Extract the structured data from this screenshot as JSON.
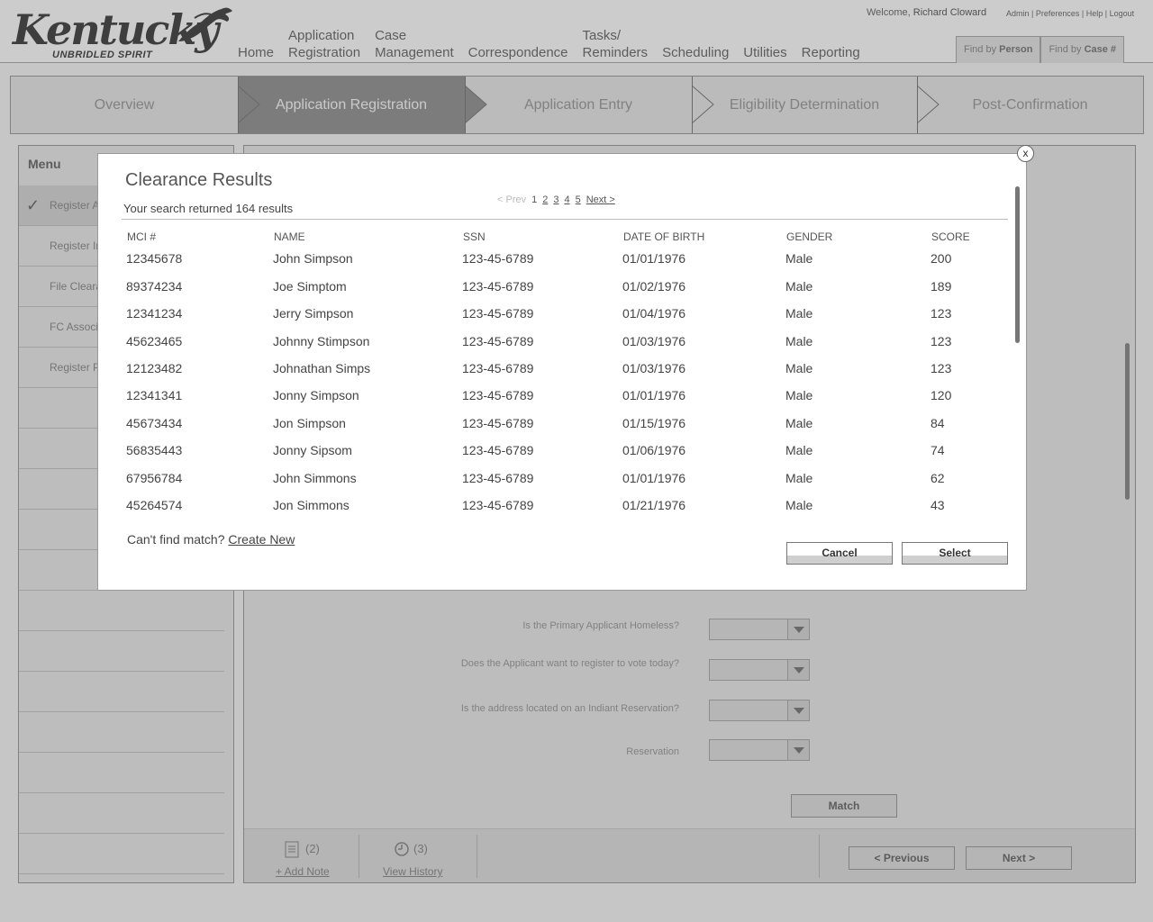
{
  "header": {
    "logo_word": "Kentucky",
    "logo_tagline": "UNBRIDLED SPIRIT",
    "nav": [
      {
        "line1": "",
        "line2": "Home"
      },
      {
        "line1": "Application",
        "line2": "Registration"
      },
      {
        "line1": "Case",
        "line2": "Management"
      },
      {
        "line1": "",
        "line2": "Correspondence"
      },
      {
        "line1": "Tasks/",
        "line2": "Reminders"
      },
      {
        "line1": "",
        "line2": "Scheduling"
      },
      {
        "line1": "",
        "line2": "Utilities"
      },
      {
        "line1": "",
        "line2": "Reporting"
      }
    ],
    "welcome_prefix": "Welcome,",
    "user_name": "Richard Cloward",
    "links": {
      "admin": "Admin",
      "preferences": "Preferences",
      "help": "Help",
      "logout": "Logout",
      "sep": " | "
    },
    "find_person": {
      "prefix": "Find by ",
      "bold": "Person"
    },
    "find_case": {
      "prefix": "Find by ",
      "bold": "Case #"
    }
  },
  "steps": [
    {
      "label": "Overview",
      "active": false
    },
    {
      "label": "Application Registration",
      "active": true
    },
    {
      "label": "Application Entry",
      "active": false
    },
    {
      "label": "Eligibility Determination",
      "active": false
    },
    {
      "label": "Post-Confirmation",
      "active": false
    }
  ],
  "menu": {
    "title": "Menu",
    "items": [
      "Register A",
      "Register In",
      "File Cleara",
      "FC Associa",
      "Register P"
    ]
  },
  "form": {
    "q1": "Is the Primary Applicant Homeless?",
    "q2": "Does the Applicant want to register to vote today?",
    "q3": "Is the address located on an Indiant Reservation?",
    "q4": "Reservation",
    "match_label": "Match",
    "add_note_count": "(2)",
    "add_note_label": "+ Add Note",
    "history_count": "(3)",
    "history_label": "View History",
    "previous_label": "< Previous",
    "next_label": "Next >"
  },
  "modal": {
    "title": "Clearance Results",
    "count_text": "Your search returned 164 results",
    "pager": {
      "prev": "< Prev",
      "pages": [
        "1",
        "2",
        "3",
        "4",
        "5"
      ],
      "next": "Next >"
    },
    "columns": [
      "MCI #",
      "NAME",
      "SSN",
      "DATE OF BIRTH",
      "GENDER",
      "SCORE"
    ],
    "rows": [
      [
        "12345678",
        "John Simpson",
        "123-45-6789",
        "01/01/1976",
        "Male",
        "200"
      ],
      [
        "89374234",
        "Joe Simptom",
        "123-45-6789",
        "01/02/1976",
        "Male",
        "189"
      ],
      [
        "12341234",
        "Jerry Simpson",
        "123-45-6789",
        "01/04/1976",
        "Male",
        "123"
      ],
      [
        "45623465",
        "Johnny Stimpson",
        "123-45-6789",
        "01/03/1976",
        "Male",
        "123"
      ],
      [
        "12123482",
        "Johnathan Simps",
        "123-45-6789",
        "01/03/1976",
        "Male",
        "123"
      ],
      [
        "12341341",
        "Jonny Simpson",
        "123-45-6789",
        "01/01/1976",
        "Male",
        "120"
      ],
      [
        "45673434",
        "Jon Simpson",
        "123-45-6789",
        "01/15/1976",
        "Male",
        "84"
      ],
      [
        "56835443",
        "Jonny Sipsom",
        "123-45-6789",
        "01/06/1976",
        "Male",
        "74"
      ],
      [
        "67956784",
        "John Simmons",
        "123-45-6789",
        "01/01/1976",
        "Male",
        "62"
      ],
      [
        "45264574",
        "Jon Simmons",
        "123-45-6789",
        "01/21/1976",
        "Male",
        "43"
      ]
    ],
    "cant_find": "Can't find match?",
    "create_new": "Create New",
    "cancel_label": "Cancel",
    "select_label": "Select",
    "close_glyph": "x"
  }
}
